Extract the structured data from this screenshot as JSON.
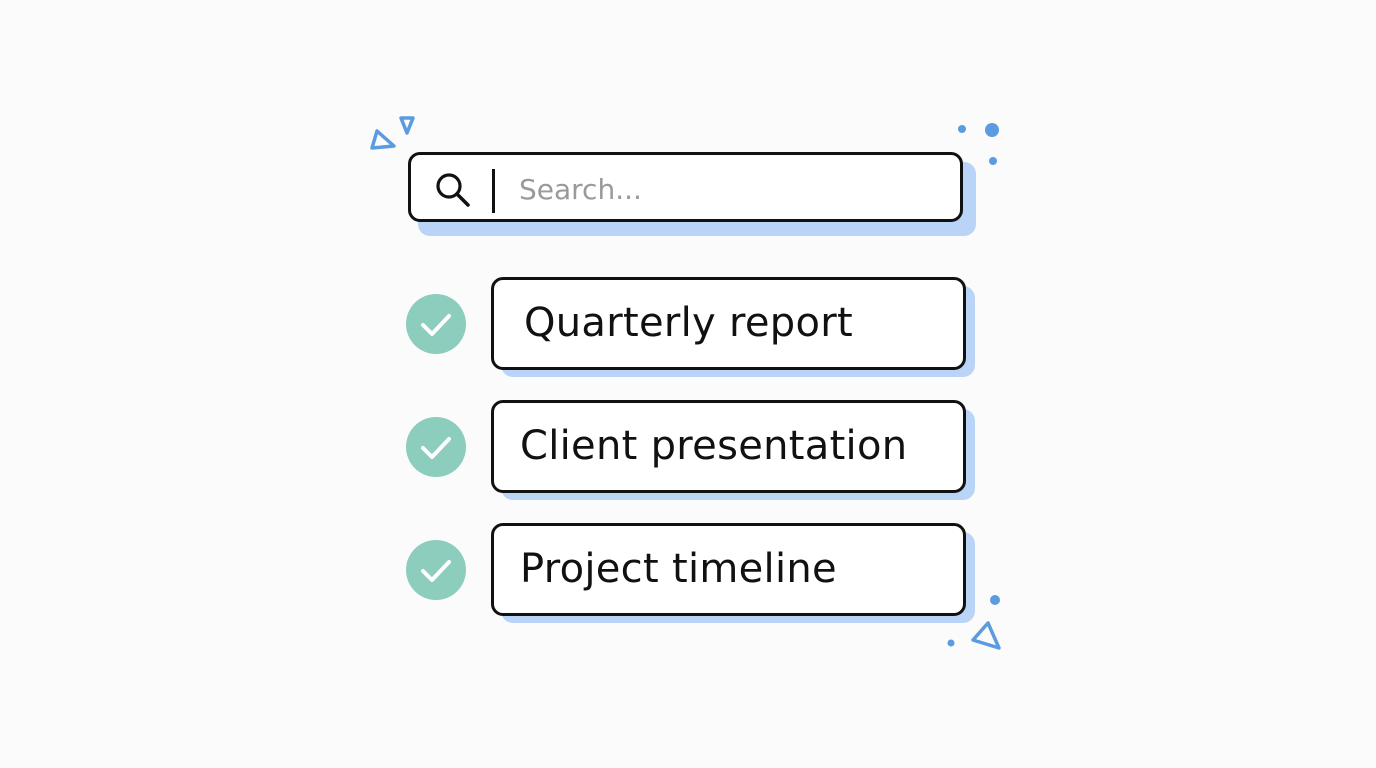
{
  "search": {
    "placeholder": "Search..."
  },
  "tasks": [
    {
      "label": "Quarterly report",
      "checked": true
    },
    {
      "label": "Client presentation",
      "checked": true
    },
    {
      "label": "Project timeline",
      "checked": true
    }
  ],
  "icons": {
    "search": "search-icon",
    "check": "check-icon"
  },
  "colors": {
    "accent_blue": "#5b9be0",
    "shadow_blue": "#b9d4f6",
    "check_green": "#8ccdbd",
    "border": "#111111",
    "placeholder": "#9a9a9a"
  }
}
